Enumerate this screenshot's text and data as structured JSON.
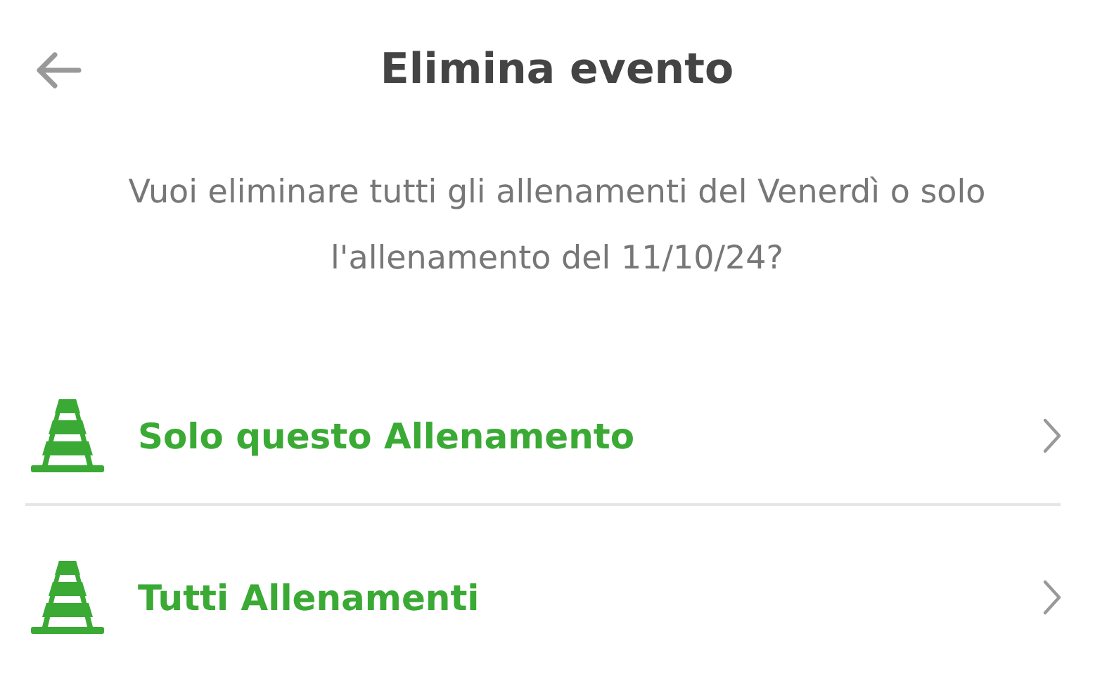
{
  "header": {
    "title": "Elimina evento"
  },
  "message": "Vuoi eliminare tutti gli allenamenti del Venerdì o solo l'allenamento del 11/10/24?",
  "options": [
    {
      "label": "Solo questo Allenamento"
    },
    {
      "label": "Tutti Allenamenti"
    }
  ]
}
